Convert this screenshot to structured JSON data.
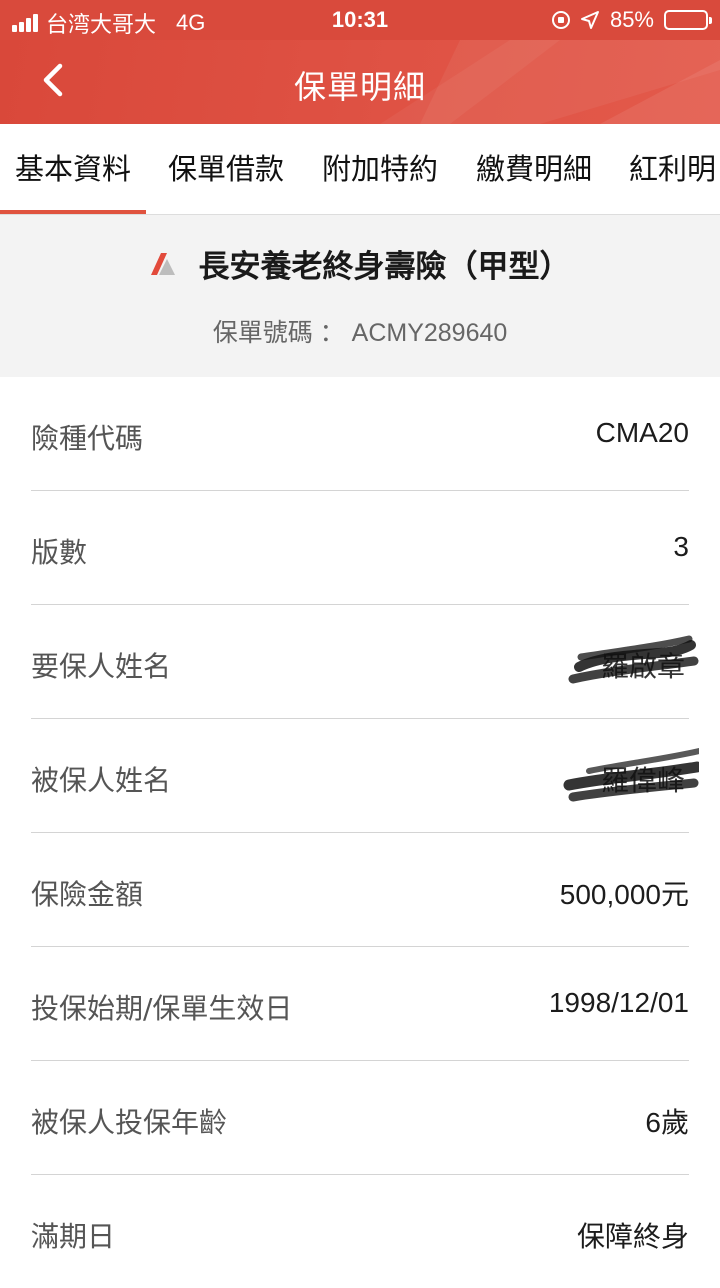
{
  "status_bar": {
    "carrier": "台湾大哥大",
    "network": "4G",
    "time": "10:31",
    "battery": "85%",
    "battery_level": 0.85,
    "icons": [
      "signal-icon",
      "orientation-lock-icon",
      "location-arrow-icon",
      "battery-icon"
    ]
  },
  "nav": {
    "title": "保單明細",
    "back_icon": "chevron-left-icon"
  },
  "tabs": [
    {
      "label": "基本資料",
      "active": true
    },
    {
      "label": "保單借款",
      "active": false
    },
    {
      "label": "附加特約",
      "active": false
    },
    {
      "label": "繳費明細",
      "active": false
    },
    {
      "label": "紅利明",
      "active": false
    }
  ],
  "policy": {
    "plan_name": "長安養老終身壽險（甲型）",
    "policy_no_label": "保單號碼",
    "policy_no_sep": "：",
    "policy_no": "ACMY289640",
    "logo_icon": "brand-logo-icon"
  },
  "details": [
    {
      "label": "險種代碼",
      "value": "CMA20"
    },
    {
      "label": "版數",
      "value": "3"
    },
    {
      "label": "要保人姓名",
      "value": "羅啟章",
      "redacted": true
    },
    {
      "label": "被保人姓名",
      "value": "羅偉峰",
      "redacted": true
    },
    {
      "label": "保險金額",
      "value": "500,000元"
    },
    {
      "label": "投保始期/保單生效日",
      "value": "1998/12/01"
    },
    {
      "label": "被保人投保年齡",
      "value": "6歲"
    },
    {
      "label": "滿期日",
      "value": "保障終身"
    }
  ],
  "colors": {
    "accent": "#d94a3c",
    "tab_indicator": "#e0533f",
    "header_bg": "#f3f3f3",
    "divider": "#d4d4d4"
  }
}
